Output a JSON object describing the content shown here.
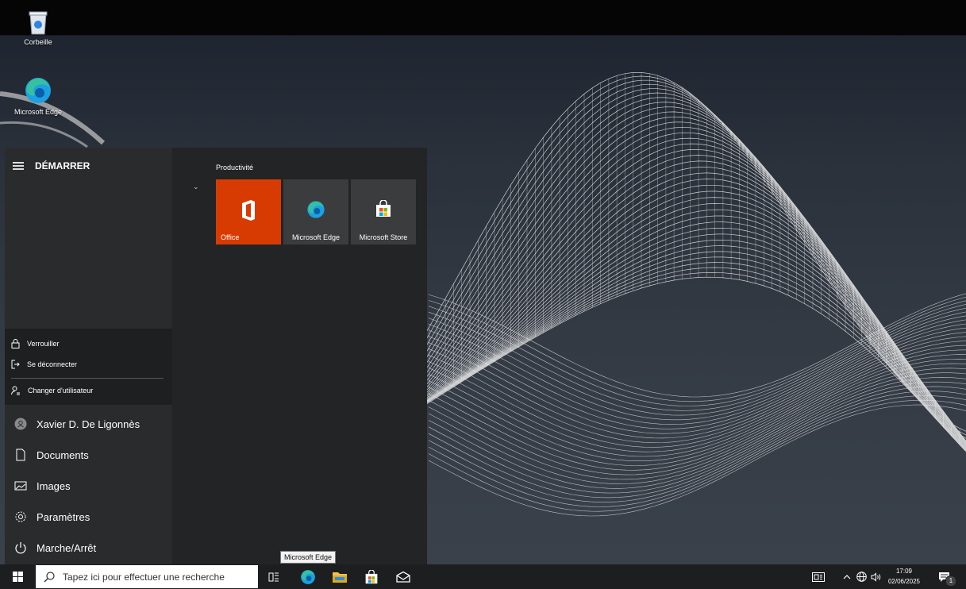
{
  "desktop": {
    "icons": [
      {
        "label": "Corbeille",
        "icon": "recycle-bin-icon"
      },
      {
        "label": "Microsoft Edge",
        "icon": "edge-icon"
      }
    ]
  },
  "start_menu": {
    "title": "DÉMARRER",
    "user_flyout": {
      "lock": "Verrouiller",
      "sign_out": "Se déconnecter",
      "switch_user": "Changer d'utilisateur"
    },
    "left_items": {
      "user": "Xavier D. De Ligonnès",
      "documents": "Documents",
      "images": "Images",
      "settings": "Paramètres",
      "power": "Marche/Arrêt"
    },
    "group": "Productivité",
    "tiles": [
      {
        "label": "Office",
        "color": "#d83b01"
      },
      {
        "label": "Microsoft Edge",
        "color": "#3b3c3e"
      },
      {
        "label": "Microsoft Store",
        "color": "#3b3c3e"
      }
    ]
  },
  "tooltip": "Microsoft Edge",
  "taskbar": {
    "search_placeholder": "Tapez ici pour effectuer une recherche",
    "pinned": [
      "task-view-icon",
      "edge-icon",
      "file-explorer-icon",
      "store-icon",
      "mail-icon"
    ],
    "time": "17:09",
    "date": "02/06/2025",
    "notifications": "1"
  },
  "colors": {
    "accent": "#d83b01",
    "taskbar": "#1d1e1f",
    "start_bg": "#232425"
  }
}
